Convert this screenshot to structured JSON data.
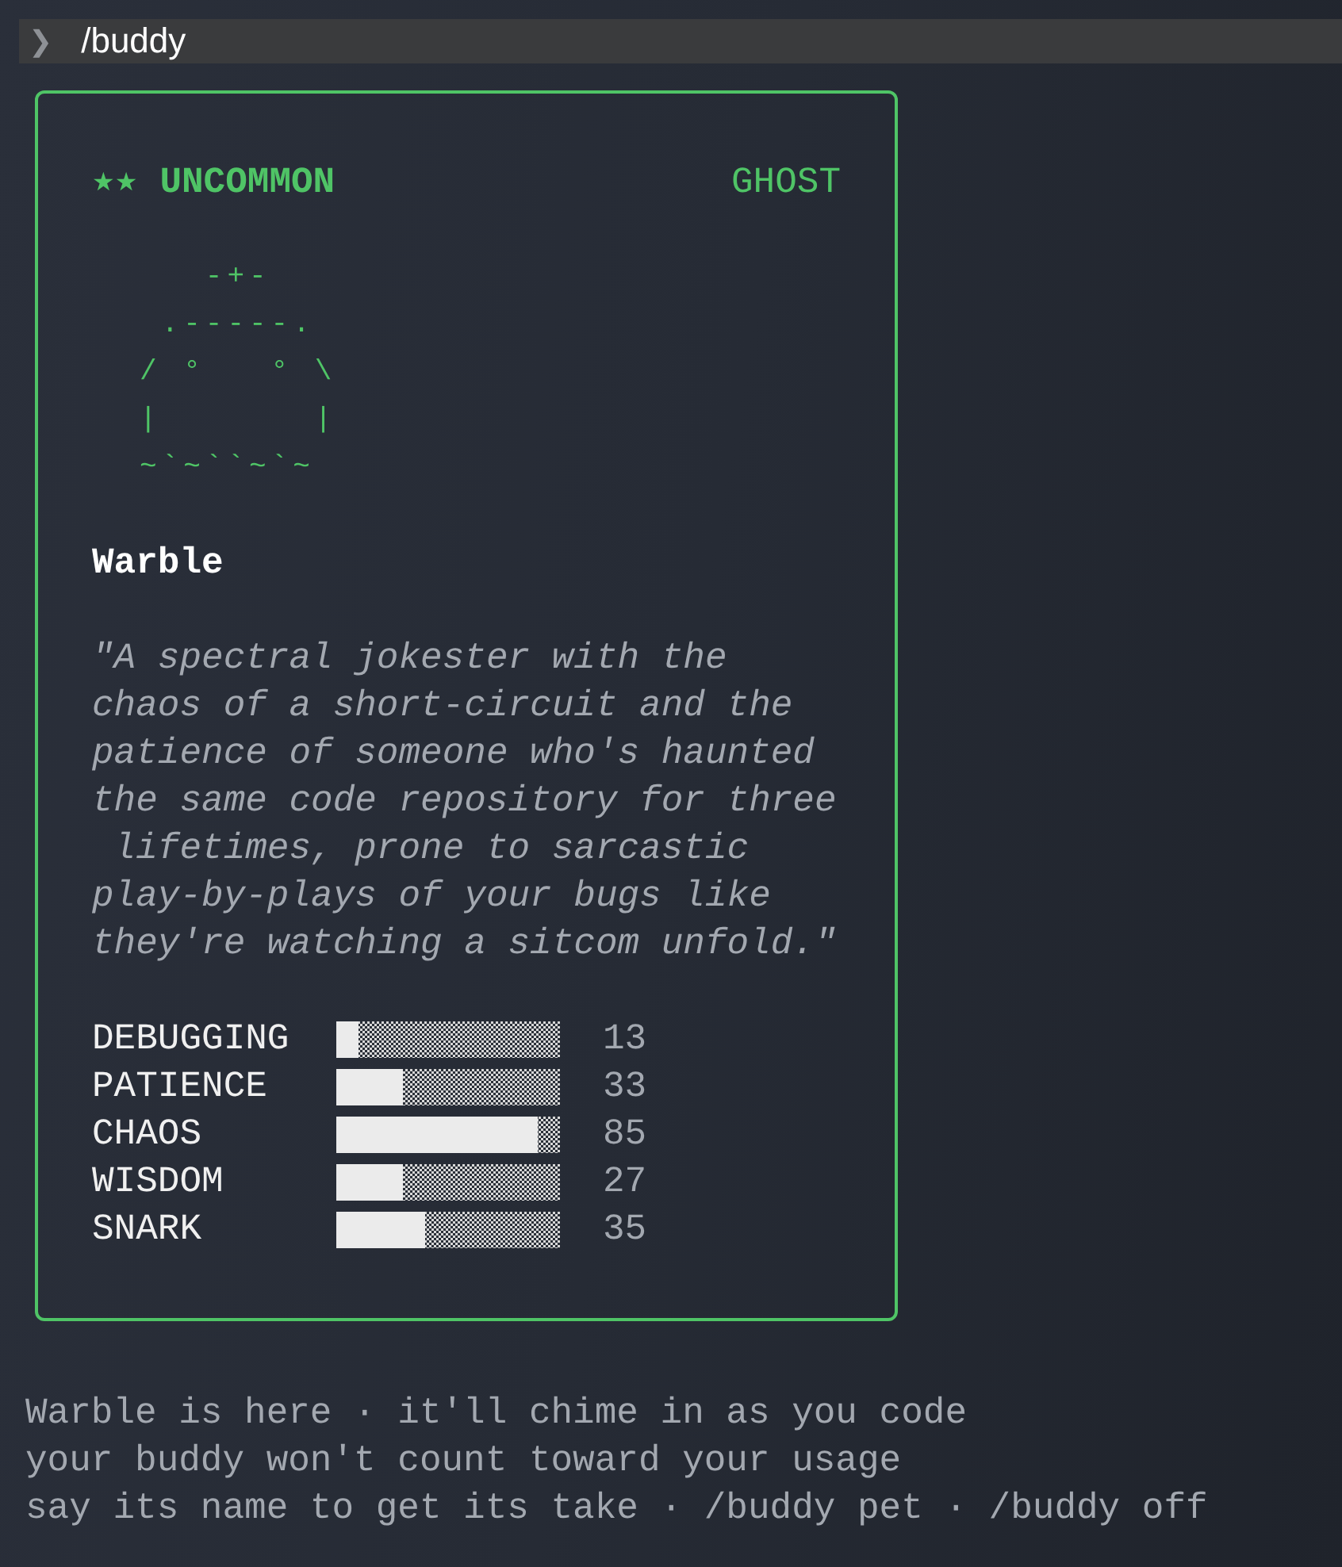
{
  "prompt": {
    "symbol": "❯",
    "command": "/buddy"
  },
  "card": {
    "stars": "★★",
    "rarity": "UNCOMMON",
    "species": "GHOST",
    "art": [
      "   -+-",
      " .-----.",
      "/ °   ° \\",
      "|       |",
      "~`~``~`~"
    ],
    "name": "Warble",
    "description": "\"A spectral jokester with the\nchaos of a short-circuit and the\npatience of someone who's haunted\nthe same code repository for three\n lifetimes, prone to sarcastic\nplay-by-plays of your bugs like\nthey're watching a sitcom unfold.\"",
    "stats": [
      {
        "label": "DEBUGGING",
        "level": 0.1,
        "value": "13"
      },
      {
        "label": "PATIENCE",
        "level": 0.3,
        "value": "33"
      },
      {
        "label": "CHAOS",
        "level": 0.9,
        "value": "85"
      },
      {
        "label": "WISDOM",
        "level": 0.3,
        "value": "27"
      },
      {
        "label": "SNARK",
        "level": 0.4,
        "value": "35"
      }
    ]
  },
  "messages": [
    "Warble is here · it'll chime in as you code",
    "your buddy won't count toward your usage",
    "say its name to get its take · /buddy pet · /buddy off"
  ]
}
